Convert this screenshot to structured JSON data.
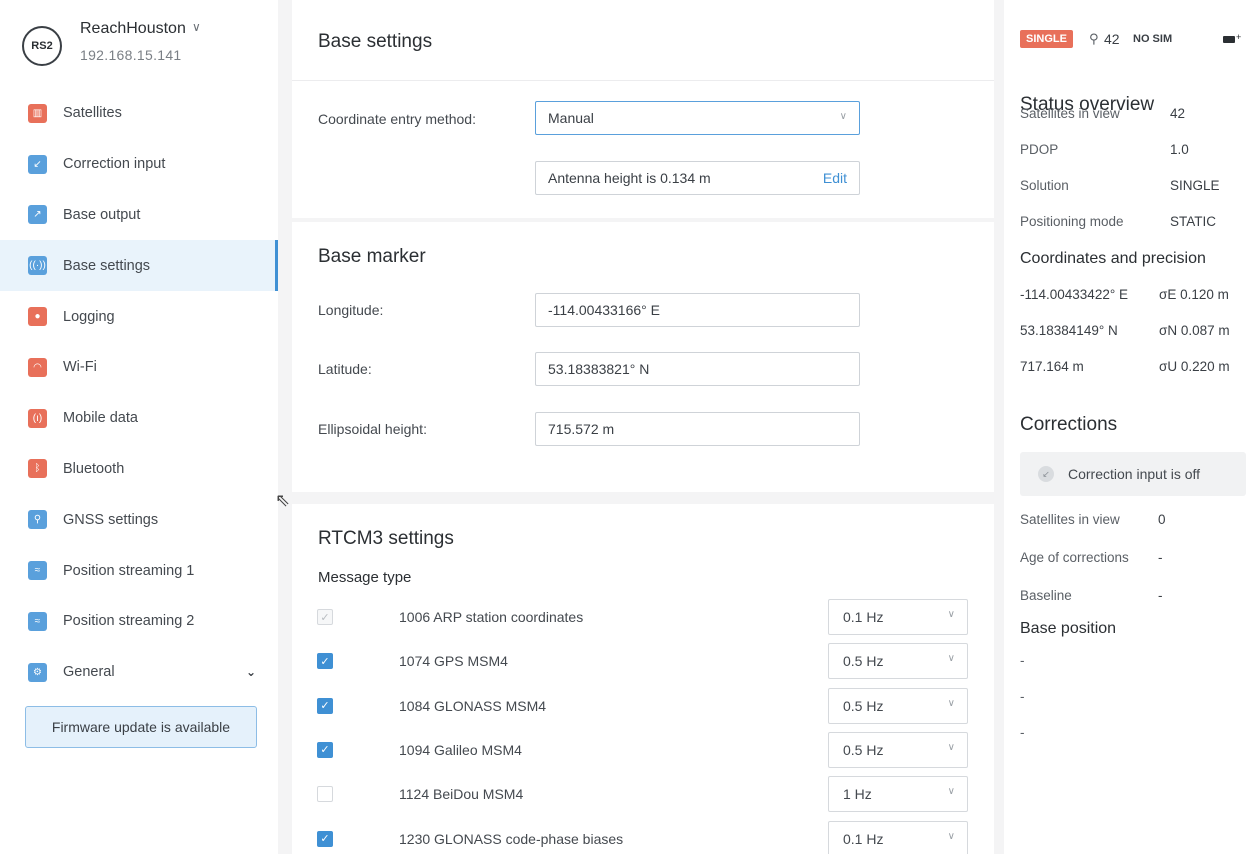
{
  "device": {
    "logo": "RS2",
    "name": "ReachHouston",
    "ip": "192.168.15.141"
  },
  "sidebar": {
    "items": [
      {
        "label": "Satellites",
        "icon": "satellites-icon",
        "glyph": "▥",
        "color": "red"
      },
      {
        "label": "Correction input",
        "icon": "correction-input-icon",
        "glyph": "↙",
        "color": "blue"
      },
      {
        "label": "Base output",
        "icon": "base-output-icon",
        "glyph": "↗",
        "color": "blue"
      },
      {
        "label": "Base settings",
        "icon": "base-settings-icon",
        "glyph": "((·))",
        "color": "blue",
        "active": true
      },
      {
        "label": "Logging",
        "icon": "logging-icon",
        "glyph": "●",
        "color": "red"
      },
      {
        "label": "Wi-Fi",
        "icon": "wifi-icon",
        "glyph": "◠",
        "color": "red"
      },
      {
        "label": "Mobile data",
        "icon": "mobile-data-icon",
        "glyph": "(ı)",
        "color": "red"
      },
      {
        "label": "Bluetooth",
        "icon": "bluetooth-icon",
        "glyph": "ᛒ",
        "color": "red"
      },
      {
        "label": "GNSS settings",
        "icon": "gnss-settings-icon",
        "glyph": "⚲",
        "color": "blue"
      },
      {
        "label": "Position streaming 1",
        "icon": "position-streaming-icon",
        "glyph": "≈",
        "color": "blue"
      },
      {
        "label": "Position streaming 2",
        "icon": "position-streaming-icon",
        "glyph": "≈",
        "color": "blue"
      },
      {
        "label": "General",
        "icon": "general-icon",
        "glyph": "⚙",
        "color": "blue",
        "chevron": "⌄"
      }
    ],
    "firmware_notice": "Firmware update is available"
  },
  "base_settings": {
    "title": "Base settings",
    "coordinate_entry_label": "Coordinate entry method:",
    "coordinate_entry_value": "Manual",
    "antenna_height": "Antenna height is 0.134 m",
    "edit_label": "Edit"
  },
  "base_marker": {
    "title": "Base marker",
    "longitude_label": "Longitude:",
    "longitude_value": "-114.00433166° E",
    "latitude_label": "Latitude:",
    "latitude_value": "53.18383821° N",
    "height_label": "Ellipsoidal height:",
    "height_value": "715.572 m"
  },
  "rtcm3": {
    "title": "RTCM3 settings",
    "message_type_label": "Message type",
    "messages": [
      {
        "label": "1006 ARP station coordinates",
        "rate": "0.1 Hz",
        "state": "dim"
      },
      {
        "label": "1074 GPS MSM4",
        "rate": "0.5 Hz",
        "state": "on"
      },
      {
        "label": "1084 GLONASS MSM4",
        "rate": "0.5 Hz",
        "state": "on"
      },
      {
        "label": "1094 Galileo MSM4",
        "rate": "0.5 Hz",
        "state": "on"
      },
      {
        "label": "1124 BeiDou MSM4",
        "rate": "1 Hz",
        "state": "off"
      },
      {
        "label": "1230 GLONASS code-phase biases",
        "rate": "0.1 Hz",
        "state": "on"
      }
    ]
  },
  "status_bar": {
    "solution_badge": "SINGLE",
    "satellites": "42",
    "sim": "NO SIM",
    "badge_color": "#e8705a"
  },
  "status_overview": {
    "title": "Status overview",
    "rows": [
      {
        "label": "Satellites in view",
        "value": "42"
      },
      {
        "label": "PDOP",
        "value": "1.0"
      },
      {
        "label": "Solution",
        "value": "SINGLE"
      },
      {
        "label": "Positioning mode",
        "value": "STATIC"
      }
    ]
  },
  "coordinates": {
    "title": "Coordinates and precision",
    "rows": [
      {
        "coord": "-114.00433422° E",
        "precision": "σE 0.120 m"
      },
      {
        "coord": "53.18384149° N",
        "precision": "σN 0.087 m"
      },
      {
        "coord": "717.164 m",
        "precision": "σU 0.220 m"
      }
    ]
  },
  "corrections": {
    "title": "Corrections",
    "input_status": "Correction input is off",
    "rows": [
      {
        "label": "Satellites in view",
        "value": "0"
      },
      {
        "label": "Age of corrections",
        "value": "-"
      },
      {
        "label": "Baseline",
        "value": "-"
      }
    ]
  },
  "base_position": {
    "title": "Base position",
    "values": [
      "-",
      "-",
      "-"
    ]
  }
}
